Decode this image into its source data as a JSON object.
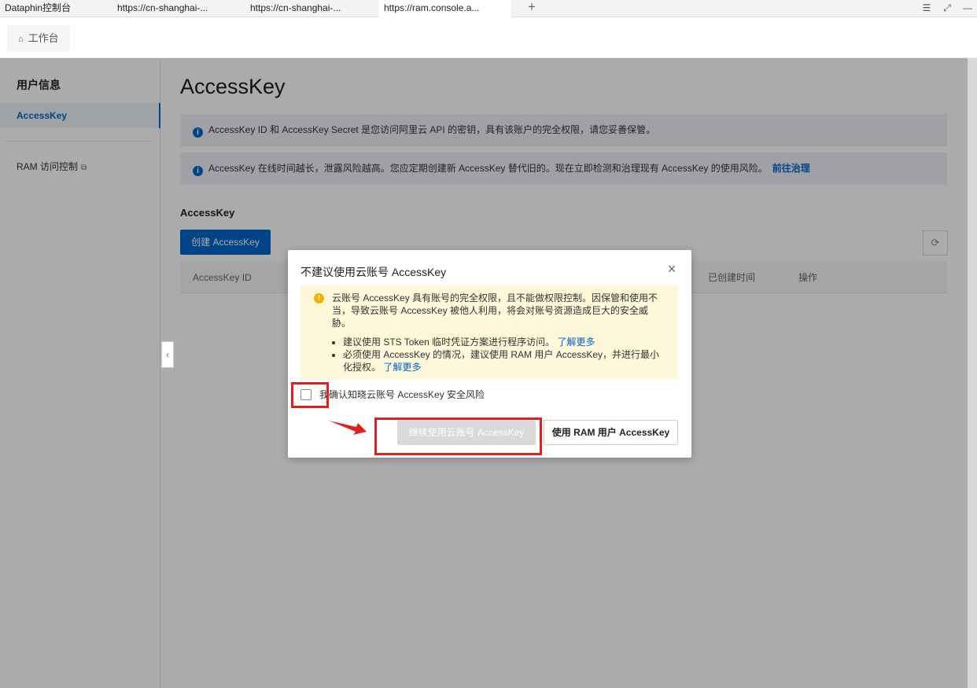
{
  "browser": {
    "tabs": [
      {
        "label": "Dataphin控制台"
      },
      {
        "label": "https://cn-shanghai-..."
      },
      {
        "label": "https://cn-shanghai-..."
      },
      {
        "label": "https://ram.console.a..."
      }
    ],
    "new_tab_symbol": "+"
  },
  "topnav": {
    "workbench_label": "工作台",
    "home_icon": "⌂"
  },
  "sidebar": {
    "title": "用户信息",
    "items": [
      {
        "label": "AccessKey",
        "active": true
      }
    ],
    "link_label": "RAM 访问控制",
    "external_icon": "⧉"
  },
  "main": {
    "title": "AccessKey",
    "notices": [
      {
        "text": "AccessKey ID 和 AccessKey Secret 是您访问阿里云 API 的密钥，具有该账户的完全权限，请您妥善保管。"
      },
      {
        "text": "AccessKey 在线时间越长，泄露风险越高。您应定期创建新 AccessKey 替代旧的。现在立即检测和治理现有 AccessKey 的使用风险。",
        "link": "前往治理"
      }
    ],
    "section_title": "AccessKey",
    "create_button": "创建 AccessKey",
    "table_headers": {
      "id": "AccessKey ID",
      "created": "已创建时间",
      "action": "操作"
    }
  },
  "modal": {
    "title": "不建议使用云账号 AccessKey",
    "warning_text": "云账号 AccessKey 具有账号的完全权限，且不能做权限控制。因保管和使用不当，导致云账号 AccessKey 被他人利用，将会对账号资源造成巨大的安全威胁。",
    "bullets": [
      {
        "text": "建议使用 STS Token 临时凭证方案进行程序访问。",
        "link": "了解更多"
      },
      {
        "text": "必须使用 AccessKey 的情况，建议使用 RAM 用户 AccessKey，并进行最小化授权。",
        "link": "了解更多"
      }
    ],
    "checkbox_label": "我确认知晓云账号 AccessKey 安全风险",
    "checkbox_checked": false,
    "continue_button": "继续使用云账号 AccessKey",
    "continue_disabled": true,
    "ram_button": "使用 RAM 用户 AccessKey"
  },
  "colors": {
    "brand": "#0064c8",
    "warning_bg": "#fff7d9",
    "annotation": "#e02020"
  }
}
